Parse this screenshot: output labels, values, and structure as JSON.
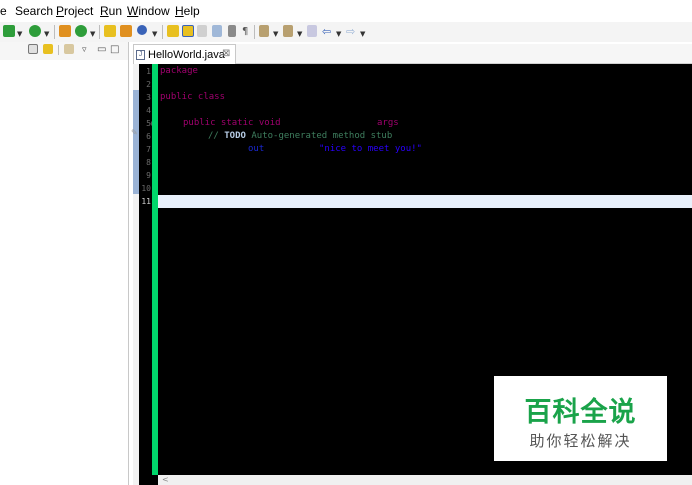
{
  "menu": {
    "items": [
      {
        "label": "e"
      },
      {
        "label": "Search"
      },
      {
        "label": "Project"
      },
      {
        "label": "Run"
      },
      {
        "label": "Window"
      },
      {
        "label": "Help"
      }
    ]
  },
  "toolbar": {
    "icons": [
      "new-wizard-icon",
      "new-java-class-icon",
      "build-icon",
      "run-icon",
      "open-type-icon",
      "search-icon",
      "next-annotation-icon",
      "back-icon",
      "forward-icon"
    ],
    "colors": {
      "green": "#2e9d3a",
      "orange": "#e09020",
      "blue": "#3a63b8",
      "yellow": "#e8c020"
    }
  },
  "editor": {
    "tab": {
      "title": "HelloWorld.java",
      "close_glyph": "⊠"
    },
    "line_numbers": [
      "1",
      "2",
      "3",
      "4",
      "5",
      "6",
      "7",
      "8",
      "9",
      "10",
      "11"
    ],
    "line5_marker": "⊖",
    "line6_marker": "✎",
    "lines": {
      "l1_keyword": "package",
      "l3_keyword": "public class",
      "l5_keyword": "public static void",
      "l5_param": "args",
      "l6_comment_prefix": "// ",
      "l6_todo": "TODO",
      "l6_comment_rest": " Auto-generated method stub",
      "l7_field": "out",
      "l7_string": "\"nice to meet you!\""
    },
    "hscroll_glyph": "<",
    "colors": {
      "background": "#000000",
      "keyword": "#a0006e",
      "comment": "#3f7f5f",
      "string": "#2a00ff",
      "current_line": "#e8f0fb",
      "change_bar": "#00d66b"
    }
  },
  "watermark": {
    "title": "百科全说",
    "subtitle": "助你轻松解决",
    "title_color": "#1aa34a"
  }
}
